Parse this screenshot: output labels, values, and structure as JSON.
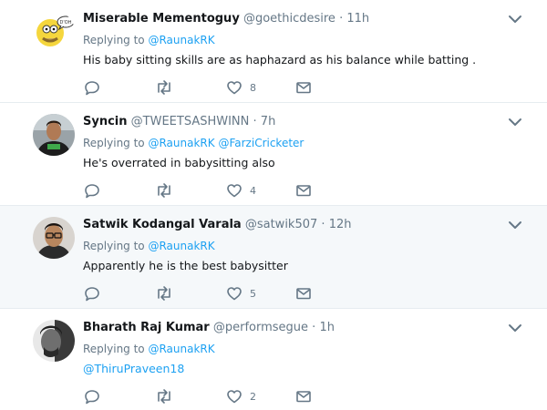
{
  "colors": {
    "link": "#1da1f2",
    "muted": "#657786",
    "text": "#14171a",
    "highlight_bg": "#f5f8fa",
    "divider": "#e6ecf0"
  },
  "replying_prefix": "Replying to",
  "tweets": [
    {
      "name": "Miserable Mementoguy",
      "handle": "@goethicdesire",
      "time": "11h",
      "mentions": [
        "@RaunakRK"
      ],
      "text": "His baby sitting skills are as haphazard as his balance while batting .",
      "likes": "8",
      "avatar_icon": "cartoon-avatar-icon"
    },
    {
      "name": "Syncin",
      "handle": "@TWEETSASHWINN",
      "time": "7h",
      "mentions": [
        "@RaunakRK",
        "@FarziCricketer"
      ],
      "text": "He's overrated in babysitting also",
      "likes": "4",
      "avatar_icon": "user-photo-icon"
    },
    {
      "name": "Satwik Kodangal Varala",
      "handle": "@satwik507",
      "time": "12h",
      "mentions": [
        "@RaunakRK"
      ],
      "text": "Apparently he is the best babysitter",
      "likes": "5",
      "avatar_icon": "user-photo-icon"
    },
    {
      "name": "Bharath Raj Kumar",
      "handle": "@performsegue",
      "time": "1h",
      "mentions": [
        "@RaunakRK"
      ],
      "text": "@ThiruPraveen18",
      "likes": "2",
      "avatar_icon": "user-photo-icon"
    }
  ]
}
